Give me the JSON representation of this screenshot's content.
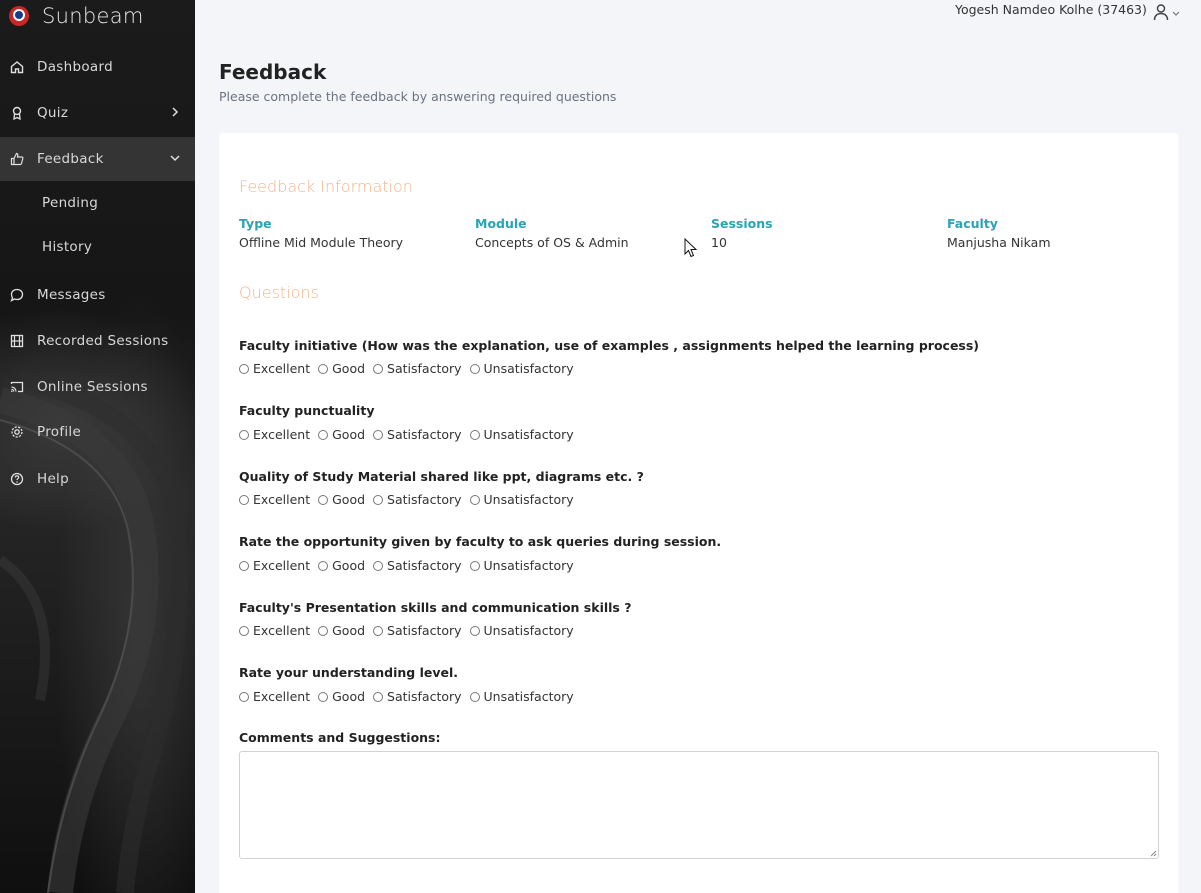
{
  "app": {
    "brand": "Sunbeam"
  },
  "user": {
    "name": "Yogesh Namdeo Kolhe (37463)",
    "icon": "user-icon"
  },
  "sidebar": {
    "items": [
      {
        "label": "Dashboard",
        "icon": "home-icon"
      },
      {
        "label": "Quiz",
        "icon": "award-icon"
      },
      {
        "label": "Feedback",
        "icon": "thumbs-up-icon"
      },
      {
        "label": "Messages",
        "icon": "message-icon"
      },
      {
        "label": "Recorded Sessions",
        "icon": "film-icon"
      },
      {
        "label": "Online Sessions",
        "icon": "cast-icon"
      },
      {
        "label": "Profile",
        "icon": "gear-icon"
      },
      {
        "label": "Help",
        "icon": "help-icon"
      }
    ],
    "feedback_sub": [
      "Pending",
      "History"
    ],
    "active": "Feedback"
  },
  "page": {
    "title": "Feedback",
    "subtitle": "Please complete the feedback by answering required questions"
  },
  "info": {
    "section_title": "Feedback Information",
    "type_label": "Type",
    "type_value": "Offline Mid Module Theory",
    "module_label": "Module",
    "module_value": "Concepts of OS & Admin",
    "sessions_label": "Sessions",
    "sessions_value": "10",
    "faculty_label": "Faculty",
    "faculty_value": "Manjusha Nikam"
  },
  "questions_title": "Questions",
  "options": [
    "Excellent",
    "Good",
    "Satisfactory",
    "Unsatisfactory"
  ],
  "questions": [
    "Faculty initiative (How was the explanation, use of examples , assignments helped the learning process)",
    "Faculty punctuality",
    "Quality of Study Material shared like ppt, diagrams etc. ?",
    "Rate the opportunity given by faculty to ask queries during session.",
    "Faculty's Presentation skills and communication skills ?",
    "Rate your understanding level."
  ],
  "comments": {
    "label": "Comments and Suggestions:",
    "value": ""
  },
  "colors": {
    "accent_teal": "#2aa3b3",
    "section_orange": "#f3b48c",
    "sidebar_bg": "#1b1b1b"
  }
}
